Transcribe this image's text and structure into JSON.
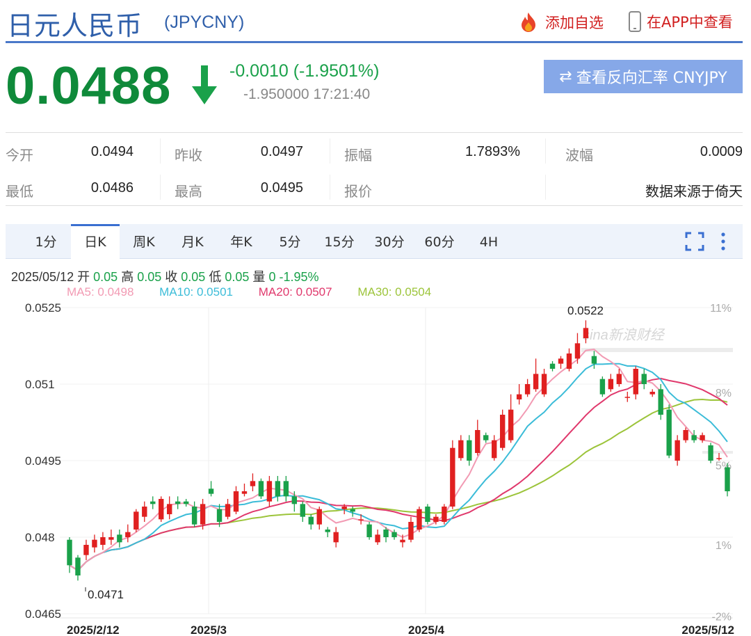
{
  "header": {
    "title": "日元人民币",
    "symbol": "(JPYCNY)",
    "add_watch": "添加自选",
    "view_app": "在APP中查看"
  },
  "quote": {
    "price": "0.0488",
    "change": "-0.0010 (-1.9501%)",
    "sub_change": "-1.950000",
    "time": "17:21:40",
    "reverse_button": "查看反向汇率 CNYJPY"
  },
  "stats": {
    "open_label": "今开",
    "open": "0.0494",
    "prev_close_label": "昨收",
    "prev_close": "0.0497",
    "amplitude_label": "振幅",
    "amplitude": "1.7893%",
    "wave_label": "波幅",
    "wave": "0.0009",
    "low_label": "最低",
    "low": "0.0486",
    "high_label": "最高",
    "high": "0.0495",
    "quote_label": "报价",
    "source": "数据来源于倚天"
  },
  "tabs": [
    "1分",
    "日K",
    "周K",
    "月K",
    "年K",
    "5分",
    "15分",
    "30分",
    "60分",
    "4H"
  ],
  "active_tab": "日K",
  "bar_info": {
    "date": "2025/05/12",
    "open_label": "开",
    "open": "0.05",
    "high_label": "高",
    "high": "0.05",
    "close_label": "收",
    "close": "0.05",
    "low_label": "低",
    "low": "0.05",
    "vol_label": "量",
    "vol": "0",
    "pct": "-1.95%"
  },
  "ma_legend": [
    {
      "label": "MA5: 0.0498",
      "color": "#f29ab3"
    },
    {
      "label": "MA10: 0.0501",
      "color": "#3bbcd8"
    },
    {
      "label": "MA20: 0.0507",
      "color": "#e0386c"
    },
    {
      "label": "MA30: 0.0504",
      "color": "#9cc43a"
    }
  ],
  "colors": {
    "up": "#e02020",
    "down": "#1aa14a",
    "accent": "#2f5faa"
  },
  "watermark": "sina新浪财经",
  "chart_data": {
    "type": "candlestick",
    "ylim": [
      0.0465,
      0.0525
    ],
    "yticks": [
      "0.0525",
      "0.051",
      "0.0495",
      "0.048",
      "0.0465"
    ],
    "pct_ticks": [
      "11%",
      "8%",
      "5%",
      "1%",
      "-2%"
    ],
    "xticks": [
      "2025/2/12",
      "2025/3",
      "2025/4",
      "2025/5/12"
    ],
    "max_label": "0.0522",
    "min_label": "0.0471",
    "candles": [
      [
        0.04795,
        0.04745,
        0.048,
        0.0473
      ],
      [
        0.0476,
        0.04725,
        0.04765,
        0.04715
      ],
      [
        0.04765,
        0.04785,
        0.04795,
        0.04755
      ],
      [
        0.0478,
        0.04795,
        0.04805,
        0.0477
      ],
      [
        0.04785,
        0.048,
        0.0481,
        0.04775
      ],
      [
        0.04795,
        0.048,
        0.04815,
        0.04785
      ],
      [
        0.04805,
        0.0479,
        0.04815,
        0.0478
      ],
      [
        0.048,
        0.0481,
        0.04825,
        0.0479
      ],
      [
        0.04815,
        0.0485,
        0.04855,
        0.0481
      ],
      [
        0.0484,
        0.0486,
        0.0487,
        0.0483
      ],
      [
        0.0487,
        0.04865,
        0.0488,
        0.04855
      ],
      [
        0.04835,
        0.04875,
        0.0488,
        0.0483
      ],
      [
        0.04845,
        0.04865,
        0.0488,
        0.04835
      ],
      [
        0.0487,
        0.04865,
        0.0488,
        0.04855
      ],
      [
        0.0487,
        0.04865,
        0.04875,
        0.0486
      ],
      [
        0.0486,
        0.04825,
        0.0487,
        0.0482
      ],
      [
        0.04825,
        0.04865,
        0.04875,
        0.04815
      ],
      [
        0.04895,
        0.04885,
        0.0491,
        0.0488
      ],
      [
        0.04855,
        0.0483,
        0.04865,
        0.0482
      ],
      [
        0.0484,
        0.04865,
        0.04875,
        0.04835
      ],
      [
        0.0485,
        0.0489,
        0.049,
        0.04845
      ],
      [
        0.04885,
        0.0489,
        0.04905,
        0.0488
      ],
      [
        0.049,
        0.0491,
        0.04925,
        0.0489
      ],
      [
        0.0491,
        0.0488,
        0.04915,
        0.04875
      ],
      [
        0.0487,
        0.0491,
        0.0492,
        0.0486
      ],
      [
        0.0491,
        0.0488,
        0.0492,
        0.0487
      ],
      [
        0.0491,
        0.0488,
        0.0492,
        0.0487
      ],
      [
        0.0488,
        0.04865,
        0.0489,
        0.0485
      ],
      [
        0.04865,
        0.0484,
        0.0487,
        0.0483
      ],
      [
        0.0484,
        0.04825,
        0.04845,
        0.04815
      ],
      [
        0.04825,
        0.04855,
        0.0486,
        0.04815
      ],
      [
        0.04815,
        0.0481,
        0.0482,
        0.048
      ],
      [
        0.0479,
        0.0481,
        0.0482,
        0.0478
      ],
      [
        0.04855,
        0.0486,
        0.04865,
        0.04845
      ],
      [
        0.04855,
        0.0485,
        0.0486,
        0.0484
      ],
      [
        0.04835,
        0.04835,
        0.04845,
        0.04825
      ],
      [
        0.04825,
        0.048,
        0.0483,
        0.04795
      ],
      [
        0.0479,
        0.04805,
        0.04815,
        0.04785
      ],
      [
        0.04815,
        0.048,
        0.0482,
        0.0479
      ],
      [
        0.0481,
        0.048,
        0.04815,
        0.04795
      ],
      [
        0.0479,
        0.04795,
        0.04805,
        0.0478
      ],
      [
        0.04795,
        0.0483,
        0.0484,
        0.0479
      ],
      [
        0.04815,
        0.04855,
        0.0486,
        0.0481
      ],
      [
        0.0486,
        0.0483,
        0.04865,
        0.04825
      ],
      [
        0.0483,
        0.0484,
        0.04845,
        0.04825
      ],
      [
        0.0483,
        0.0486,
        0.04865,
        0.04825
      ],
      [
        0.0486,
        0.04975,
        0.0499,
        0.04855
      ],
      [
        0.04955,
        0.0499,
        0.05,
        0.0495
      ],
      [
        0.0499,
        0.0495,
        0.05,
        0.0494
      ],
      [
        0.04965,
        0.0501,
        0.0503,
        0.0496
      ],
      [
        0.05,
        0.0499,
        0.05005,
        0.04985
      ],
      [
        0.04955,
        0.0499,
        0.05,
        0.0495
      ],
      [
        0.04975,
        0.0504,
        0.0505,
        0.0497
      ],
      [
        0.0499,
        0.0505,
        0.0508,
        0.04985
      ],
      [
        0.0507,
        0.0508,
        0.051,
        0.0506
      ],
      [
        0.0508,
        0.051,
        0.0511,
        0.05075
      ],
      [
        0.0509,
        0.0512,
        0.0515,
        0.05085
      ],
      [
        0.0508,
        0.0512,
        0.0513,
        0.05075
      ],
      [
        0.0514,
        0.0513,
        0.05145,
        0.05125
      ],
      [
        0.0514,
        0.0515,
        0.05155,
        0.0513
      ],
      [
        0.0513,
        0.0516,
        0.0517,
        0.05125
      ],
      [
        0.0515,
        0.0518,
        0.052,
        0.0514
      ],
      [
        0.0519,
        0.0521,
        0.05225,
        0.0518
      ],
      [
        0.05155,
        0.0514,
        0.05165,
        0.0513
      ],
      [
        0.0511,
        0.0508,
        0.05115,
        0.05075
      ],
      [
        0.0509,
        0.0511,
        0.0512,
        0.05085
      ],
      [
        0.051,
        0.0512,
        0.0513,
        0.05095
      ],
      [
        0.05075,
        0.05075,
        0.05085,
        0.05065
      ],
      [
        0.0508,
        0.0513,
        0.05135,
        0.0507
      ],
      [
        0.0512,
        0.051,
        0.0513,
        0.0509
      ],
      [
        0.0508,
        0.05085,
        0.0509,
        0.05075
      ],
      [
        0.0509,
        0.0504,
        0.051,
        0.0503
      ],
      [
        0.0505,
        0.0496,
        0.0506,
        0.04955
      ],
      [
        0.0495,
        0.0499,
        0.05,
        0.0494
      ],
      [
        0.0499,
        0.0501,
        0.05015,
        0.04985
      ],
      [
        0.05,
        0.0499,
        0.0501,
        0.04985
      ],
      [
        0.0499,
        0.05,
        0.05005,
        0.04985
      ],
      [
        0.0498,
        0.0495,
        0.04985,
        0.04945
      ],
      [
        0.04955,
        0.04955,
        0.04965,
        0.0495
      ],
      [
        0.04937,
        0.0489,
        0.04945,
        0.0488
      ]
    ]
  }
}
